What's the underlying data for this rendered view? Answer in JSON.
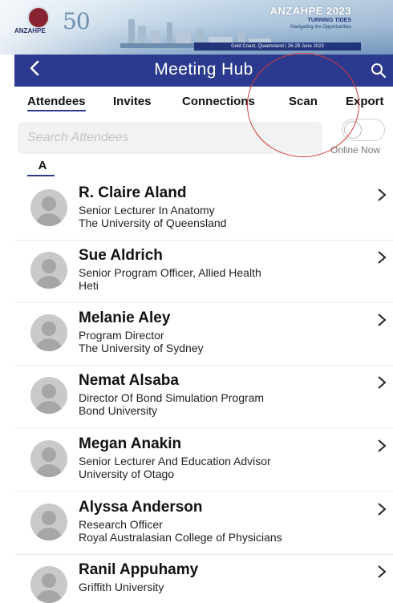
{
  "banner": {
    "org_logo_text": "ANZAHPE",
    "anniversary": "50",
    "conference_name": "ANZAHPE 2023",
    "tagline_1": "TURNING TIDES",
    "tagline_2": "Navigating the Opportunities",
    "location_strip": "Gold Coast, Queensland | 26-29 June 2023"
  },
  "header": {
    "back_icon": "chevron-left-icon",
    "title": "Meeting Hub",
    "search_icon": "search-icon"
  },
  "tabs": [
    {
      "label": "Attendees",
      "active": true
    },
    {
      "label": "Invites",
      "active": false
    },
    {
      "label": "Connections",
      "active": false
    },
    {
      "label": "Scan",
      "active": false
    },
    {
      "label": "Export",
      "active": false
    }
  ],
  "search": {
    "placeholder": "Search Attendees",
    "value": ""
  },
  "online_toggle": {
    "label": "Online Now",
    "on": false
  },
  "section_letter": "A",
  "attendees": [
    {
      "name": "R. Claire Aland",
      "title": "Senior Lecturer In Anatomy",
      "org": "The University of Queensland"
    },
    {
      "name": "Sue Aldrich",
      "title": "Senior Program Officer, Allied Health",
      "org": "Heti"
    },
    {
      "name": "Melanie Aley",
      "title": "Program Director",
      "org": "The University of Sydney"
    },
    {
      "name": "Nemat Alsaba",
      "title": "Director Of Bond Simulation Program",
      "org": "Bond University"
    },
    {
      "name": "Megan Anakin",
      "title": "Senior Lecturer And Education Advisor",
      "org": "University of Otago"
    },
    {
      "name": "Alyssa Anderson",
      "title": "Research Officer",
      "org": "Royal Australasian College of Physicians"
    },
    {
      "name": "Ranil Appuhamy",
      "title": "Griffith University",
      "org": ""
    }
  ],
  "colors": {
    "brand_navy": "#2b3a8e",
    "annotation_red": "#d23a3a"
  }
}
